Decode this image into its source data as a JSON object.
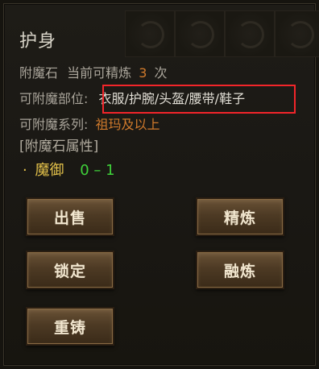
{
  "tooltip": {
    "title": "护身",
    "line1": {
      "label": "附魔石",
      "refine_label": "当前可精炼",
      "refine_count": "3",
      "unit": "次"
    },
    "line2": {
      "label": "可附魔部位:",
      "value": "衣服/护腕/头盔/腰带/鞋子"
    },
    "line3": {
      "label": "可附魔系列:",
      "value": "祖玛及以上"
    },
    "attr_header": "[附魔石属性]",
    "attr": {
      "bullet": "·",
      "name": "魔御",
      "value": "0 – 1"
    }
  },
  "buttons": {
    "sell": "出售",
    "refine": "精炼",
    "lock": "锁定",
    "fuse": "融炼",
    "recast": "重铸"
  },
  "colors": {
    "highlight_box": "#f2252a",
    "orange_text": "#d07a2c",
    "green_value": "#3fd23a",
    "attr_name": "#e3c14a"
  }
}
